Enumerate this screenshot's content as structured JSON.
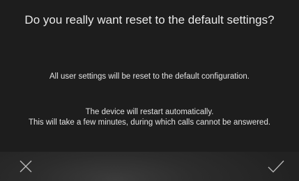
{
  "dialog": {
    "title": "Do you really want reset to the default settings?",
    "message": "All user settings will be reset to the default configuration.",
    "note_line1": "The device will restart automatically.",
    "note_line2": "This will take a few minutes, during which calls cannot be answered."
  },
  "actions": {
    "cancel_icon": "close-icon",
    "confirm_icon": "checkmark-icon"
  },
  "colors": {
    "background": "#1d1d1d",
    "text": "#e6e6e6",
    "bar": "#2c2c2c"
  }
}
